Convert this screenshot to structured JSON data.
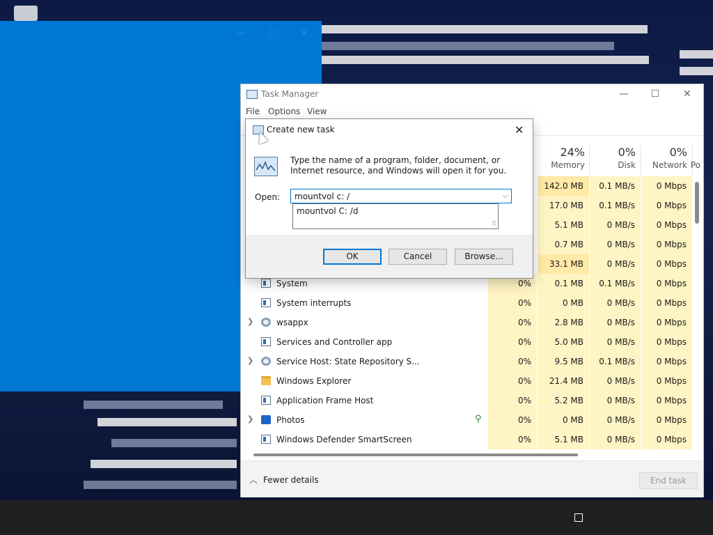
{
  "task_manager": {
    "title": "Task Manager",
    "menu": [
      "File",
      "Options",
      "View"
    ],
    "columns": {
      "memory": {
        "pct": "24%",
        "label": "Memory"
      },
      "disk": {
        "pct": "0%",
        "label": "Disk"
      },
      "network": {
        "pct": "0%",
        "label": "Network"
      },
      "power_partial": "Po"
    },
    "rows": [
      {
        "name": "",
        "cpu": "",
        "memory": "142.0 MB",
        "disk": "0.1 MB/s",
        "network": "0 Mbps"
      },
      {
        "name": "",
        "cpu": "",
        "memory": "17.0 MB",
        "disk": "0.1 MB/s",
        "network": "0 Mbps"
      },
      {
        "name": "",
        "cpu": "",
        "memory": "5.1 MB",
        "disk": "0 MB/s",
        "network": "0 Mbps"
      },
      {
        "name": "",
        "cpu": "",
        "memory": "0.7 MB",
        "disk": "0 MB/s",
        "network": "0 Mbps"
      },
      {
        "name": "",
        "cpu": "",
        "memory": "33.1 MB",
        "disk": "0 MB/s",
        "network": "0 Mbps"
      },
      {
        "name": "System",
        "cpu": "0%",
        "memory": "0.1 MB",
        "disk": "0.1 MB/s",
        "network": "0 Mbps"
      },
      {
        "name": "System interrupts",
        "cpu": "0%",
        "memory": "0 MB",
        "disk": "0 MB/s",
        "network": "0 Mbps"
      },
      {
        "name": "wsappx",
        "cpu": "0%",
        "memory": "2.8 MB",
        "disk": "0 MB/s",
        "network": "0 Mbps"
      },
      {
        "name": "Services and Controller app",
        "cpu": "0%",
        "memory": "5.0 MB",
        "disk": "0 MB/s",
        "network": "0 Mbps"
      },
      {
        "name": "Service Host: State Repository S...",
        "cpu": "0%",
        "memory": "9.5 MB",
        "disk": "0.1 MB/s",
        "network": "0 Mbps"
      },
      {
        "name": "Windows Explorer",
        "cpu": "0%",
        "memory": "21.4 MB",
        "disk": "0 MB/s",
        "network": "0 Mbps"
      },
      {
        "name": "Application Frame Host",
        "cpu": "0%",
        "memory": "5.2 MB",
        "disk": "0 MB/s",
        "network": "0 Mbps"
      },
      {
        "name": "Photos",
        "cpu": "0%",
        "memory": "0 MB",
        "disk": "0 MB/s",
        "network": "0 Mbps"
      },
      {
        "name": "Windows Defender SmartScreen",
        "cpu": "0%",
        "memory": "5.1 MB",
        "disk": "0 MB/s",
        "network": "0 Mbps"
      }
    ],
    "fewer_details": "Fewer details",
    "end_task": "End task"
  },
  "dialog": {
    "title": "Create new task",
    "description": "Type the name of a program, folder, document, or Internet resource, and Windows will open it for you.",
    "open_label": "Open:",
    "input_value": "mountvol c: /",
    "suggestion": "mountvol C: /d",
    "ok": "OK",
    "cancel": "Cancel",
    "browse": "Browse..."
  }
}
